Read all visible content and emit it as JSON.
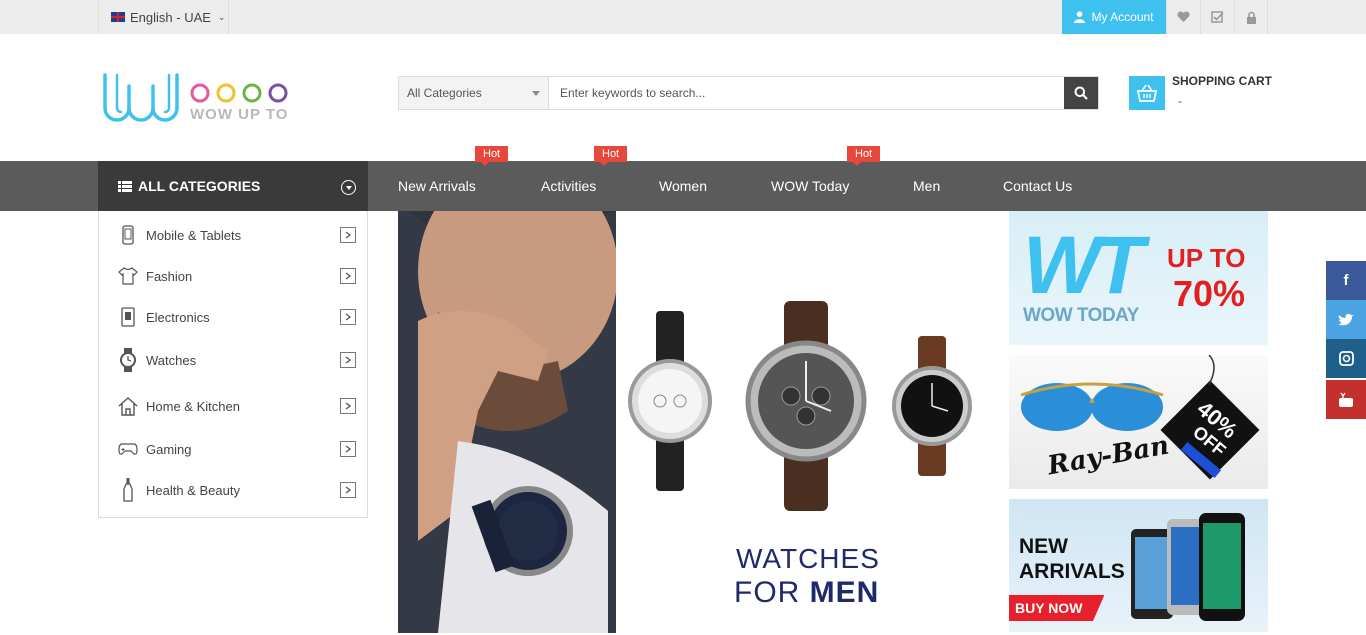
{
  "topbar": {
    "language": "English - UAE",
    "account_label": "My Account",
    "icons": [
      "user-icon",
      "heart-icon",
      "checklist-icon",
      "lock-icon"
    ]
  },
  "header": {
    "logo_text": "WOW UP TO",
    "search": {
      "category_value": "All Categories",
      "placeholder": "Enter keywords to search..."
    },
    "cart": {
      "title": "SHOPPING CART",
      "summary": "-"
    }
  },
  "nav": {
    "all_categories": "ALL CATEGORIES",
    "items": [
      {
        "label": "New Arrivals",
        "badge": "Hot"
      },
      {
        "label": "Activities",
        "badge": "Hot"
      },
      {
        "label": "Women",
        "badge": ""
      },
      {
        "label": "WOW Today",
        "badge": "Hot"
      },
      {
        "label": "Men",
        "badge": ""
      },
      {
        "label": "Contact Us",
        "badge": ""
      }
    ]
  },
  "categories": [
    {
      "label": "Mobile & Tablets",
      "icon": "mobile-icon"
    },
    {
      "label": "Fashion",
      "icon": "shirt-icon"
    },
    {
      "label": "Electronics",
      "icon": "device-icon"
    },
    {
      "label": "Watches",
      "icon": "watch-icon"
    },
    {
      "label": "Home & Kitchen",
      "icon": "home-icon"
    },
    {
      "label": "Gaming",
      "icon": "gamepad-icon"
    },
    {
      "label": "Health & Beauty",
      "icon": "bottle-icon"
    }
  ],
  "hero": {
    "title_line1": "WATCHES",
    "title_line2_a": "FOR ",
    "title_line2_b": "MEN"
  },
  "promos": {
    "wow_today": {
      "logo": "WT",
      "text": "WOW TODAY",
      "up_to": "UP TO",
      "percent": "70%"
    },
    "rayban": {
      "brand": "Ray-Ban",
      "discount": "40%",
      "off": "OFF"
    },
    "new_arrivals": {
      "line1": "NEW",
      "line2": "ARRIVALS",
      "cta": "BUY NOW"
    }
  },
  "social": [
    {
      "name": "facebook",
      "glyph": "f",
      "color": "#3b5998"
    },
    {
      "name": "twitter",
      "glyph": "t",
      "color": "#4ba3e2"
    },
    {
      "name": "instagram",
      "glyph": "◎",
      "color": "#1f5f8b"
    },
    {
      "name": "youtube",
      "glyph": "▶",
      "color": "#c4302b"
    }
  ],
  "colors": {
    "accent": "#3fc1f0",
    "nav_bg": "#5b5b5b",
    "hot": "#e8483c"
  }
}
